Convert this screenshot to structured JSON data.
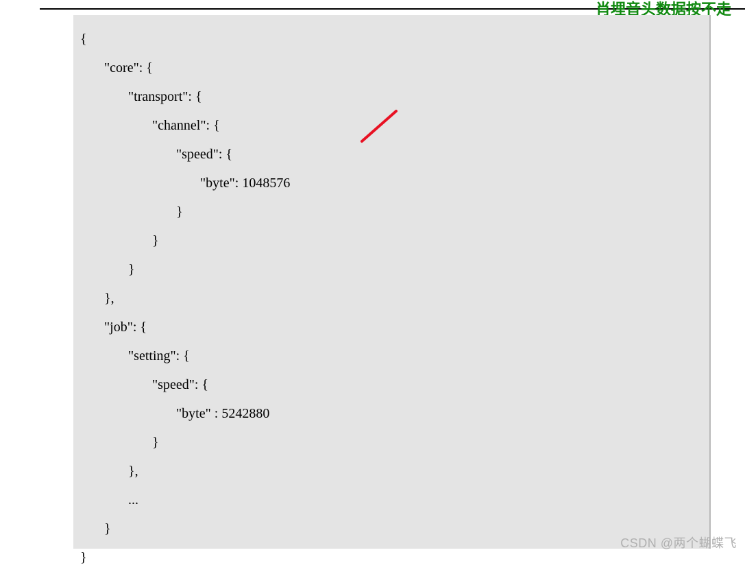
{
  "header": {
    "partial_title": "肖埋音头数据按不走"
  },
  "code": {
    "lines": [
      "{",
      "       \"core\": {",
      "              \"transport\": {",
      "                     \"channel\": {",
      "                            \"speed\": {",
      "                                   \"byte\": 1048576",
      "                            }",
      "                     }",
      "              }",
      "       },",
      "       \"job\": {",
      "              \"setting\": {",
      "                     \"speed\": {",
      "                            \"byte\" : 5242880",
      "                     }",
      "              },",
      "              ...",
      "       }",
      "}"
    ]
  },
  "config_values": {
    "core_transport_channel_speed_byte": 1048576,
    "job_setting_speed_byte": 5242880
  },
  "watermark": "CSDN @两个蝴蝶飞"
}
